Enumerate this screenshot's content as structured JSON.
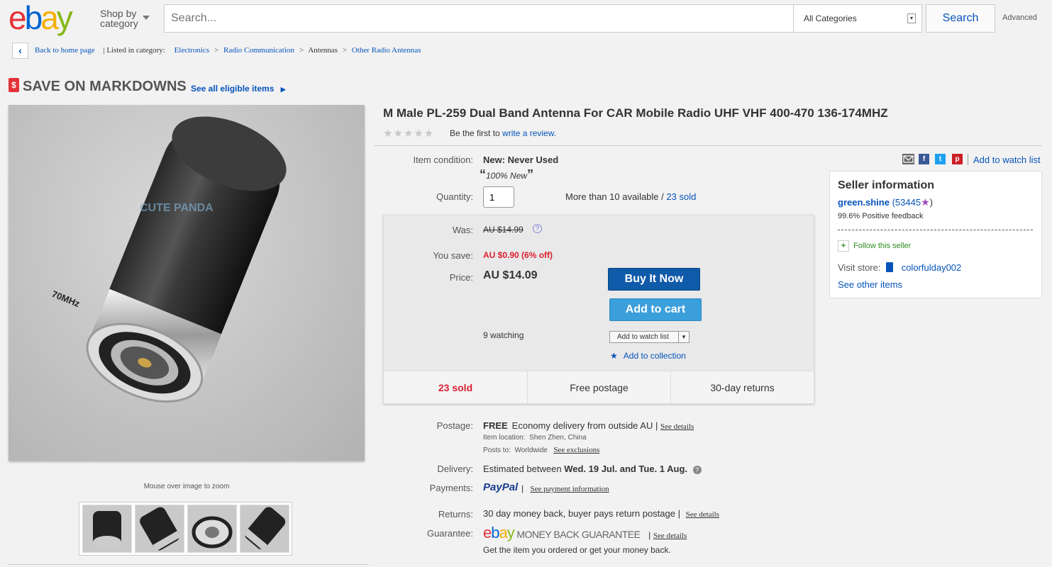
{
  "colors": {
    "accent": "#0654ba",
    "sold_red": "#dd1e31",
    "buy_now": "#0f5aa9",
    "add_cart": "#3b9fdb"
  },
  "header": {
    "logo": [
      "e",
      "b",
      "a",
      "y"
    ],
    "shop_by_line1": "Shop by",
    "shop_by_line2": "category",
    "search_placeholder": "Search...",
    "category": "All Categories",
    "search_label": "Search",
    "advanced_label": "Advanced"
  },
  "breadcrumb": {
    "back": "Back to home page",
    "listed_in": "| Listed in category:",
    "items": [
      "Electronics",
      "Radio Communication",
      "Antennas",
      "Other Radio Antennas"
    ]
  },
  "promo": {
    "title": "SAVE ON MARKDOWNS",
    "link": "See all eligible items",
    "icon": "$"
  },
  "image": {
    "zoom_hint": "Mouse over image to zoom",
    "watermark": "CUTE PANDA",
    "band_text": "70MHz",
    "thumbnail_count": 4
  },
  "item": {
    "title": "M Male PL-259 Dual Band Antenna For CAR Mobile Radio UHF VHF 400-470 136-174MHZ",
    "stars": "★★★★★",
    "review_prefix": "Be the first to",
    "review_link": "write a review.",
    "condition_label": "Item condition:",
    "condition": "New: Never Used",
    "condition_note": "100% New",
    "quantity_label": "Quantity:",
    "quantity_value": "1",
    "available": "More than 10 available /",
    "sold_link": "23 sold",
    "add_watch_top": "Add to watch list"
  },
  "price": {
    "was_label": "Was:",
    "was": "AU $14.99",
    "save_label": "You save:",
    "save": "AU $0.90 (6% off)",
    "price_label": "Price:",
    "price": "AU $14.09",
    "buy_now": "Buy It Now",
    "add_to_cart": "Add to cart",
    "watching": "9 watching",
    "watch_button": "Add to watch list",
    "add_collection": "Add to collection",
    "stat_sold": "23 sold",
    "stat_postage": "Free postage",
    "stat_returns": "30-day returns"
  },
  "shipping": {
    "postage_label": "Postage:",
    "postage_free": "FREE",
    "postage_desc": "Economy delivery from outside AU |",
    "postage_details": "See details",
    "location_label": "Item location:",
    "location": "Shen Zhen, China",
    "posts_to_label": "Posts to:",
    "posts_to": "Worldwide",
    "exclusions": "See exclusions",
    "delivery_label": "Delivery:",
    "delivery_prefix": "Estimated between",
    "delivery_dates": "Wed. 19 Jul. and Tue. 1 Aug.",
    "payments_label": "Payments:",
    "paypal": "PayPal",
    "payment_info": "See payment information",
    "returns_label": "Returns:",
    "returns": "30 day money back, buyer pays return postage |",
    "returns_details": "See details",
    "guarantee_label": "Guarantee:",
    "guarantee_text": "MONEY BACK GUARANTEE",
    "guarantee_details": "See details",
    "guarantee_note": "Get the item you ordered or get your money back."
  },
  "seller": {
    "heading": "Seller information",
    "name": "green.shine",
    "feedback_score": "(53445",
    "feedback_close": ")",
    "positive": "99.6% Positive feedback",
    "follow": "Follow this seller",
    "visit_label": "Visit store:",
    "store": "colorfulday002",
    "other_items": "See other items"
  }
}
